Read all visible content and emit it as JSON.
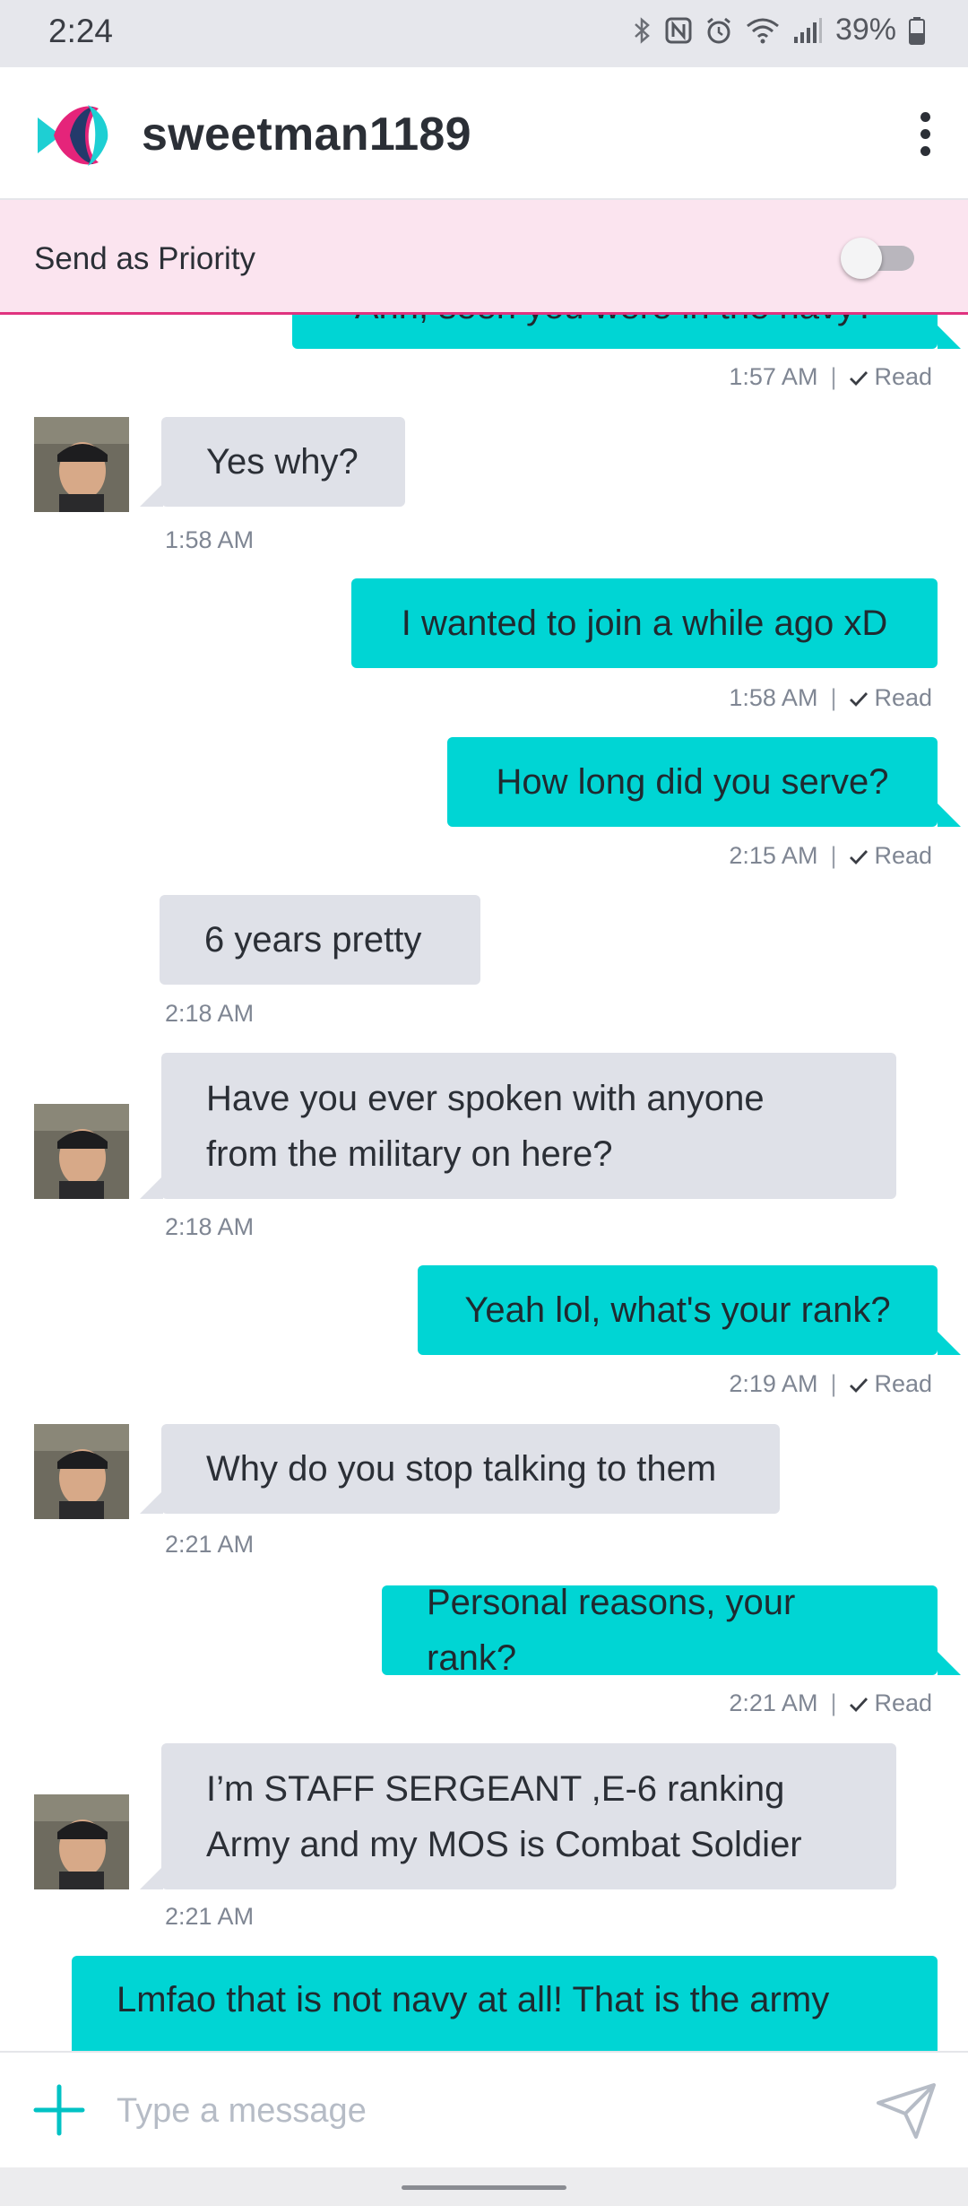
{
  "status": {
    "time": "2:24",
    "battery": "39%"
  },
  "header": {
    "contact_name": "sweetman1189"
  },
  "priority": {
    "label": "Send as Priority",
    "enabled": false
  },
  "messages": [
    {
      "dir": "out",
      "text": "Ahh, seen you were in the navy?",
      "time": "1:57 AM",
      "status": "Read"
    },
    {
      "dir": "in",
      "text": "Yes why?",
      "time": "1:58 AM"
    },
    {
      "dir": "out",
      "text": "I wanted to join a while ago xD",
      "time": "1:58 AM",
      "status": "Read"
    },
    {
      "dir": "out",
      "text": "How long did you serve?",
      "time": "2:15 AM",
      "status": "Read"
    },
    {
      "dir": "in",
      "text": "6 years pretty",
      "time": "2:18 AM"
    },
    {
      "dir": "in",
      "lines": [
        "Have you ever spoken with anyone",
        "from the military on here?"
      ],
      "time": "2:18 AM"
    },
    {
      "dir": "out",
      "text": "Yeah lol, what's your rank?",
      "time": "2:19 AM",
      "status": "Read"
    },
    {
      "dir": "in",
      "text": "Why do you stop talking to them",
      "time": "2:21 AM"
    },
    {
      "dir": "out",
      "text": "Personal reasons, your rank?",
      "time": "2:21 AM",
      "status": "Read"
    },
    {
      "dir": "in",
      "lines": [
        "I’m STAFF SERGEANT ,E-6 ranking",
        "Army and my MOS is Combat Soldier"
      ],
      "time": "2:21 AM"
    },
    {
      "dir": "out",
      "text": "Lmfao that is not navy at all! That is the army"
    }
  ],
  "composer": {
    "placeholder": "Type a message"
  },
  "icons": {
    "logo": "fish-logo-icon",
    "menu": "more-vertical-icon",
    "add": "plus-icon",
    "send": "send-icon"
  },
  "colors": {
    "outgoing": "#00d5d4",
    "incoming": "#dfe1e8",
    "priority_bg": "#fbe4ef",
    "accent_pink": "#e0337f"
  }
}
